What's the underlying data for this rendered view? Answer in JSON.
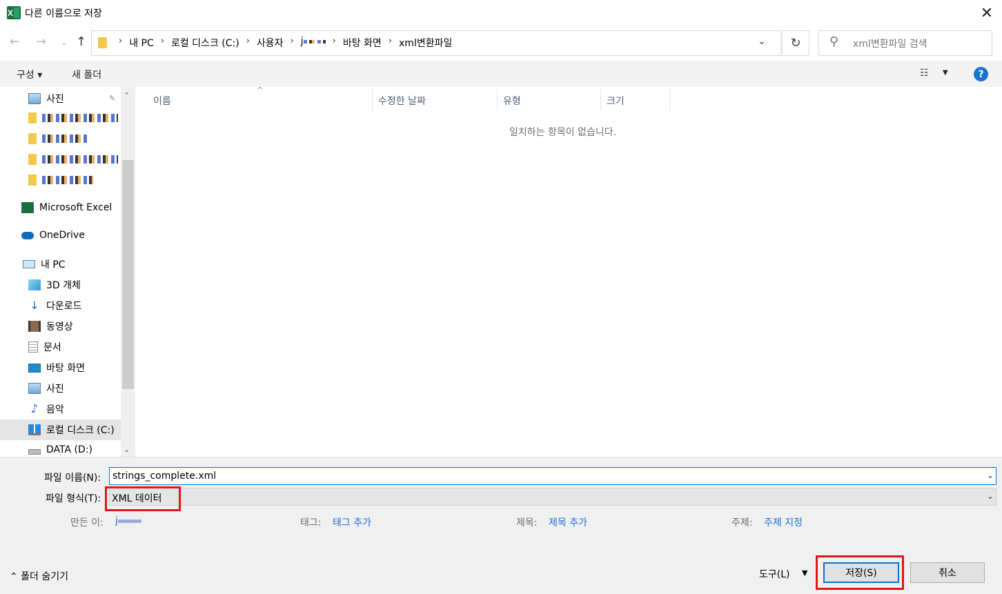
{
  "window": {
    "title": "다른 이름으로 저장",
    "close_glyph": "✕"
  },
  "navigation": {
    "back_glyph": "←",
    "forward_glyph": "→",
    "recent_glyph": "⌄",
    "up_glyph": "↑",
    "breadcrumbs": [
      "내 PC",
      "로컬 디스크 (C:)",
      "사용자",
      "j",
      "바탕 화면",
      "xml변환파일"
    ],
    "crumb_separator": "›",
    "dropdown_glyph": "⌄",
    "refresh_glyph": "↻",
    "search_placeholder": "xml변환파일 검색",
    "search_glyph": "⚲"
  },
  "commandbar": {
    "organize": "구성 ▾",
    "new_folder": "새 폴더",
    "view_glyph": "☷",
    "view_dropdown": "▼",
    "help_glyph": "?"
  },
  "sidebar": {
    "items": [
      {
        "label": "사진",
        "icon": "pictures-icon",
        "pin": "📌"
      },
      {
        "label": "",
        "icon": "folder-icon"
      },
      {
        "label": "",
        "icon": "folder-icon"
      },
      {
        "label": "",
        "icon": "folder-icon"
      },
      {
        "label": "",
        "icon": "folder-icon"
      },
      {
        "label": "Microsoft Excel",
        "icon": "excel-icon"
      },
      {
        "label": "OneDrive",
        "icon": "onedrive-icon"
      },
      {
        "label": "내 PC",
        "icon": "pc-icon"
      },
      {
        "label": "3D 개체",
        "icon": "3d-objects-icon"
      },
      {
        "label": "다운로드",
        "icon": "downloads-icon"
      },
      {
        "label": "동영상",
        "icon": "videos-icon"
      },
      {
        "label": "문서",
        "icon": "documents-icon"
      },
      {
        "label": "바탕 화면",
        "icon": "desktop-icon"
      },
      {
        "label": "사진",
        "icon": "pictures-icon"
      },
      {
        "label": "음악",
        "icon": "music-icon"
      },
      {
        "label": "로컬 디스크 (C:)",
        "icon": "local-disk-icon"
      },
      {
        "label": "DATA (D:)",
        "icon": "drive-icon"
      }
    ],
    "scroll_up": "⌃",
    "scroll_down": "⌄"
  },
  "filelist": {
    "columns": [
      "이름",
      "수정한 날짜",
      "유형",
      "크기"
    ],
    "sort_glyph": "^",
    "empty_message": "일치하는 항목이 없습니다."
  },
  "form": {
    "filename_label": "파일 이름(N):",
    "filename_value": "strings_complete.xml",
    "filetype_label": "파일 형식(T):",
    "filetype_value": "XML 데이터",
    "dropdown_glyph": "⌄",
    "author_label": "만든 이:",
    "author_value": "j",
    "tags_label": "태그:",
    "tags_value": "태그 추가",
    "title_label": "제목:",
    "title_value": "제목 추가",
    "subject_label": "주제:",
    "subject_value": "주제 지정"
  },
  "footer": {
    "hide_folders": "⌃  폴더 숨기기",
    "tools": "도구(L)",
    "tools_dropdown": "▼",
    "save": "저장(S)",
    "cancel": "취소"
  },
  "colors": {
    "accent": "#0078d7",
    "highlight": "#e3141b",
    "link": "#1e6fd6"
  }
}
